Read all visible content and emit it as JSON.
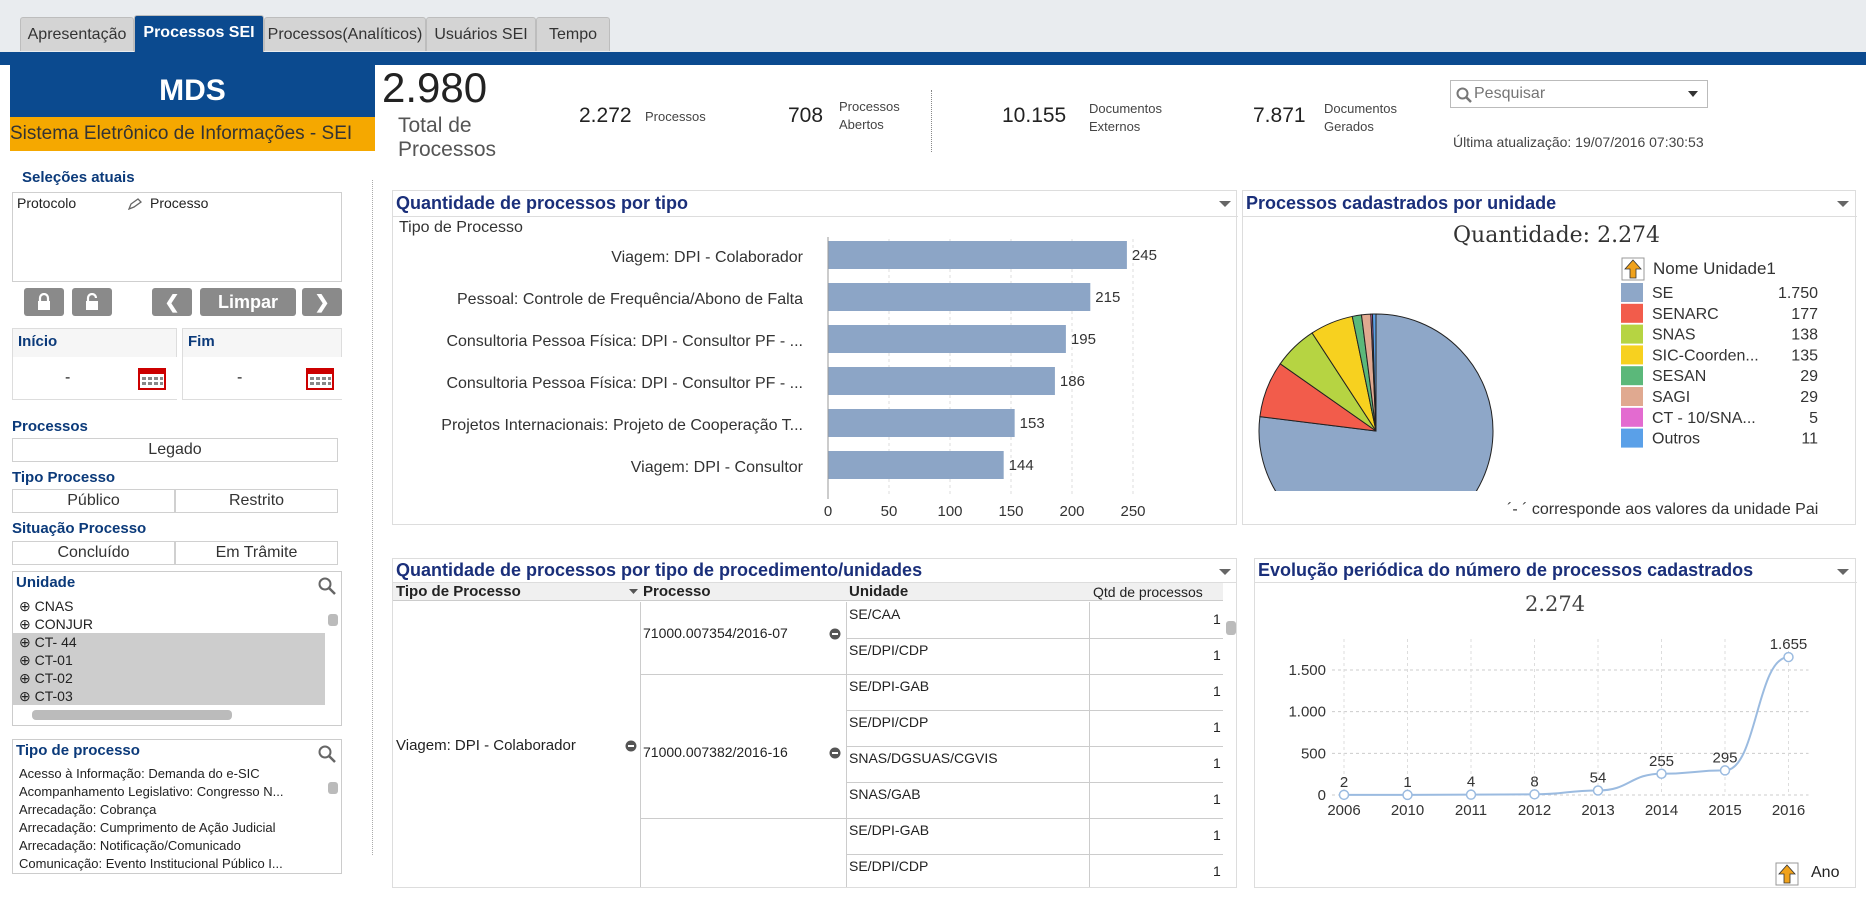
{
  "tabs": [
    "Apresentação",
    "Processos SEI",
    "Processos(Analíticos)",
    "Usuários SEI",
    "Tempo"
  ],
  "active_tab": "Processos SEI",
  "brand": {
    "title": "MDS",
    "subtitle": "Sistema Eletrônico de Informações - SEI"
  },
  "selections": {
    "title": "Seleções atuais",
    "rows": [
      {
        "field": "Protocolo",
        "value": "Processo"
      }
    ],
    "clear_label": "Limpar"
  },
  "dates": {
    "start_label": "Início",
    "end_label": "Fim",
    "start_value": "-",
    "end_value": "-"
  },
  "processos_filter": {
    "title": "Processos",
    "options": [
      "Legado"
    ]
  },
  "tipo_filter": {
    "title": "Tipo Processo",
    "options": [
      "Público",
      "Restrito"
    ]
  },
  "situacao_filter": {
    "title": "Situação Processo",
    "options": [
      "Concluído",
      "Em Trâmite"
    ]
  },
  "unidade_list": {
    "title": "Unidade",
    "items": [
      "CNAS",
      "CONJUR",
      "CT- 44",
      "CT-01",
      "CT-02",
      "CT-03"
    ]
  },
  "tipo_list": {
    "title": "Tipo de processo",
    "items": [
      "Acesso à Informação: Demanda do e-SIC",
      "Acompanhamento Legislativo: Congresso N...",
      "Arrecadação: Cobrança",
      "Arrecadação: Cumprimento de Ação Judicial",
      "Arrecadação: Notificação/Comunicado",
      "Comunicação: Evento Institucional Público I..."
    ]
  },
  "kpis": {
    "total_value": "2.980",
    "total_label": "Total de Processos",
    "processos_value": "2.272",
    "processos_label": "Processos",
    "abertos_value": "708",
    "abertos_label1": "Processos",
    "abertos_label2": "Abertos",
    "externos_value": "10.155",
    "externos_label1": "Documentos",
    "externos_label2": "Externos",
    "gerados_value": "7.871",
    "gerados_label1": "Documentos",
    "gerados_label2": "Gerados"
  },
  "search": {
    "placeholder": "Pesquisar"
  },
  "last_update": "Última atualização: 19/07/2016 07:30:53",
  "bar_panel": {
    "title": "Quantidade de processos por tipo",
    "dimension": "Tipo de Processo"
  },
  "pie_panel": {
    "title": "Processos cadastrados por unidade",
    "subtitle": "Quantidade: 2.274",
    "legend_title": "Nome Unidade1",
    "footnote": "´- ´ corresponde aos valores da unidade Pai"
  },
  "table_panel": {
    "title": "Quantidade de processos por tipo de procedimento/unidades",
    "headers": [
      "Tipo de Processo",
      "Processo",
      "Unidade",
      "Qtd de processos"
    ],
    "tipo": "Viagem: DPI - Colaborador",
    "groups": [
      {
        "processo": "71000.007354/2016-07",
        "unidades": [
          {
            "u": "SE/CAA",
            "q": "1"
          },
          {
            "u": "SE/DPI/CDP",
            "q": "1"
          }
        ]
      },
      {
        "processo": "71000.007382/2016-16",
        "unidades": [
          {
            "u": "SE/DPI-GAB",
            "q": "1"
          },
          {
            "u": "SE/DPI/CDP",
            "q": "1"
          },
          {
            "u": "SNAS/DGSUAS/CGVIS",
            "q": "1"
          },
          {
            "u": "SNAS/GAB",
            "q": "1"
          }
        ]
      },
      {
        "processo": "",
        "unidades": [
          {
            "u": "SE/DPI-GAB",
            "q": "1"
          },
          {
            "u": "SE/DPI/CDP",
            "q": "1"
          }
        ]
      }
    ]
  },
  "line_panel": {
    "title": "Evolução periódica do número de processos cadastrados",
    "subtitle": "2.274",
    "x_dim": "Ano"
  },
  "chart_data": [
    {
      "type": "bar",
      "orientation": "horizontal",
      "title": "Quantidade de processos por tipo",
      "xlabel": "",
      "ylabel": "Tipo de Processo",
      "categories": [
        "Viagem: DPI - Colaborador",
        "Pessoal: Controle de Frequência/Abono de Falta",
        "Consultoria Pessoa Física: DPI - Consultor PF - ...",
        "Consultoria Pessoa Física: DPI - Consultor PF - ...",
        "Projetos Internacionais: Projeto de Cooperação T...",
        "Viagem: DPI - Consultor"
      ],
      "values": [
        245,
        215,
        195,
        186,
        153,
        144
      ],
      "xlim": [
        0,
        250
      ],
      "ticks": [
        "0",
        "50",
        "100",
        "150",
        "200",
        "250"
      ],
      "color": "#8ca5c6",
      "grid": true
    },
    {
      "type": "pie",
      "title": "Processos cadastrados por unidade",
      "labels": [
        "SE",
        "SENARC",
        "SNAS",
        "SIC-Coorden...",
        "SESAN",
        "SAGI",
        "CT - 10/SNA...",
        "Outros"
      ],
      "values": [
        1750,
        177,
        138,
        135,
        29,
        29,
        5,
        11
      ],
      "value_labels": [
        "1.750",
        "177",
        "138",
        "135",
        "29",
        "29",
        "5",
        "11"
      ],
      "colors": [
        "#8ea7c8",
        "#f25c4b",
        "#b6d442",
        "#f7d11f",
        "#5bb87a",
        "#e0a990",
        "#e36bd0",
        "#5aa0e8"
      ],
      "legend": "right"
    },
    {
      "type": "line",
      "title": "Evolução periódica do número de processos cadastrados",
      "categories": [
        "2006",
        "2010",
        "2011",
        "2012",
        "2013",
        "2014",
        "2015",
        "2016"
      ],
      "values": [
        2,
        1,
        4,
        8,
        54,
        255,
        295,
        1655
      ],
      "value_labels": [
        "2",
        "1",
        "4",
        "8",
        "54",
        "255",
        "295",
        "1.655"
      ],
      "ylim": [
        0,
        1800
      ],
      "yticks": [
        "0",
        "500",
        "1.000",
        "1.500"
      ],
      "xlabel": "Ano",
      "grid": true,
      "color": "#9bbbe0"
    }
  ]
}
